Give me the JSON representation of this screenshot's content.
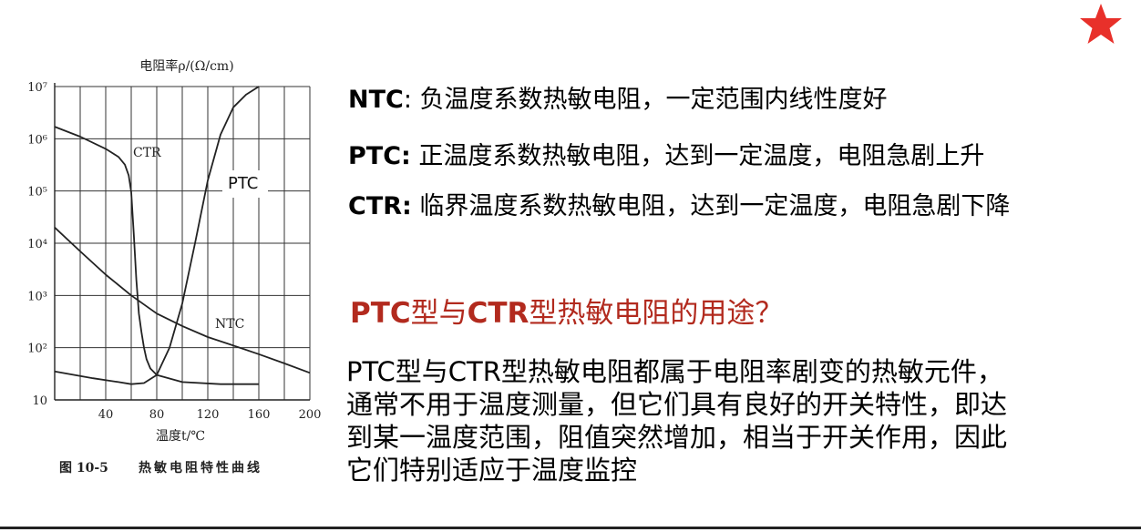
{
  "header": {
    "star_color": "#e8302a",
    "star_icon": "star-icon"
  },
  "chart_data": {
    "type": "line",
    "ylabel": "电阻率ρ/(Ω/cm)",
    "xlabel": "温度t/℃",
    "y_scale": "log",
    "ylim": [
      10,
      10000000
    ],
    "xlim": [
      0,
      200
    ],
    "grid": true,
    "y_ticks": [
      "10",
      "10²",
      "10³",
      "10⁴",
      "10⁵",
      "10⁶",
      "10⁷"
    ],
    "x_ticks": [
      "40",
      "80",
      "120",
      "160",
      "200"
    ],
    "x_tick_values": [
      40,
      80,
      120,
      160,
      200
    ],
    "caption_num": "图 10-5",
    "caption_text": "热敏电阻特性曲线",
    "series": [
      {
        "name": "CTR",
        "x": [
          0,
          20,
          40,
          50,
          55,
          58,
          60,
          62,
          64,
          66,
          68,
          70,
          72,
          75,
          80,
          100,
          130,
          160
        ],
        "y": [
          1700000,
          1100000,
          640000,
          450000,
          320000,
          200000,
          95000,
          15000,
          2000,
          450,
          200,
          100,
          60,
          40,
          30,
          22,
          20,
          20
        ]
      },
      {
        "name": "PTC",
        "x": [
          0,
          30,
          50,
          60,
          70,
          80,
          90,
          100,
          110,
          120,
          130,
          140,
          150,
          160
        ],
        "y": [
          35,
          26,
          22,
          20,
          21,
          30,
          100,
          700,
          10000,
          160000,
          1200000,
          4000000,
          7000000,
          10000000
        ]
      },
      {
        "name": "NTC",
        "x": [
          0,
          20,
          40,
          60,
          80,
          100,
          120,
          140,
          160,
          180,
          200
        ],
        "y": [
          20000,
          7000,
          2500,
          1000,
          450,
          260,
          160,
          110,
          75,
          50,
          33
        ]
      }
    ]
  },
  "text": {
    "l1_bold": "NTC",
    "l1_rest": ": 负温度系数热敏电阻，一定范围内线性度好",
    "l2_bold": "PTC:",
    "l2_rest": " 正温度系数热敏电阻，达到一定温度，电阻急剧上升",
    "l3_bold": "CTR:",
    "l3_rest": " 临界温度系数热敏电阻，达到一定温度，电阻急剧下降",
    "q_part1": "PTC",
    "q_part2": "型与",
    "q_part3": "CTR",
    "q_part4": "型热敏电阻的用途？",
    "para_lines": [
      "PTC型与CTR型热敏电阻都属于电阻率剧变的热敏元件，",
      "通常不用于温度测量，但它们具有良好的开关特性，即达",
      "到某一温度范围，阻值突然增加，相当于开关作用，因此",
      "它们特别适应于温度监控"
    ]
  }
}
